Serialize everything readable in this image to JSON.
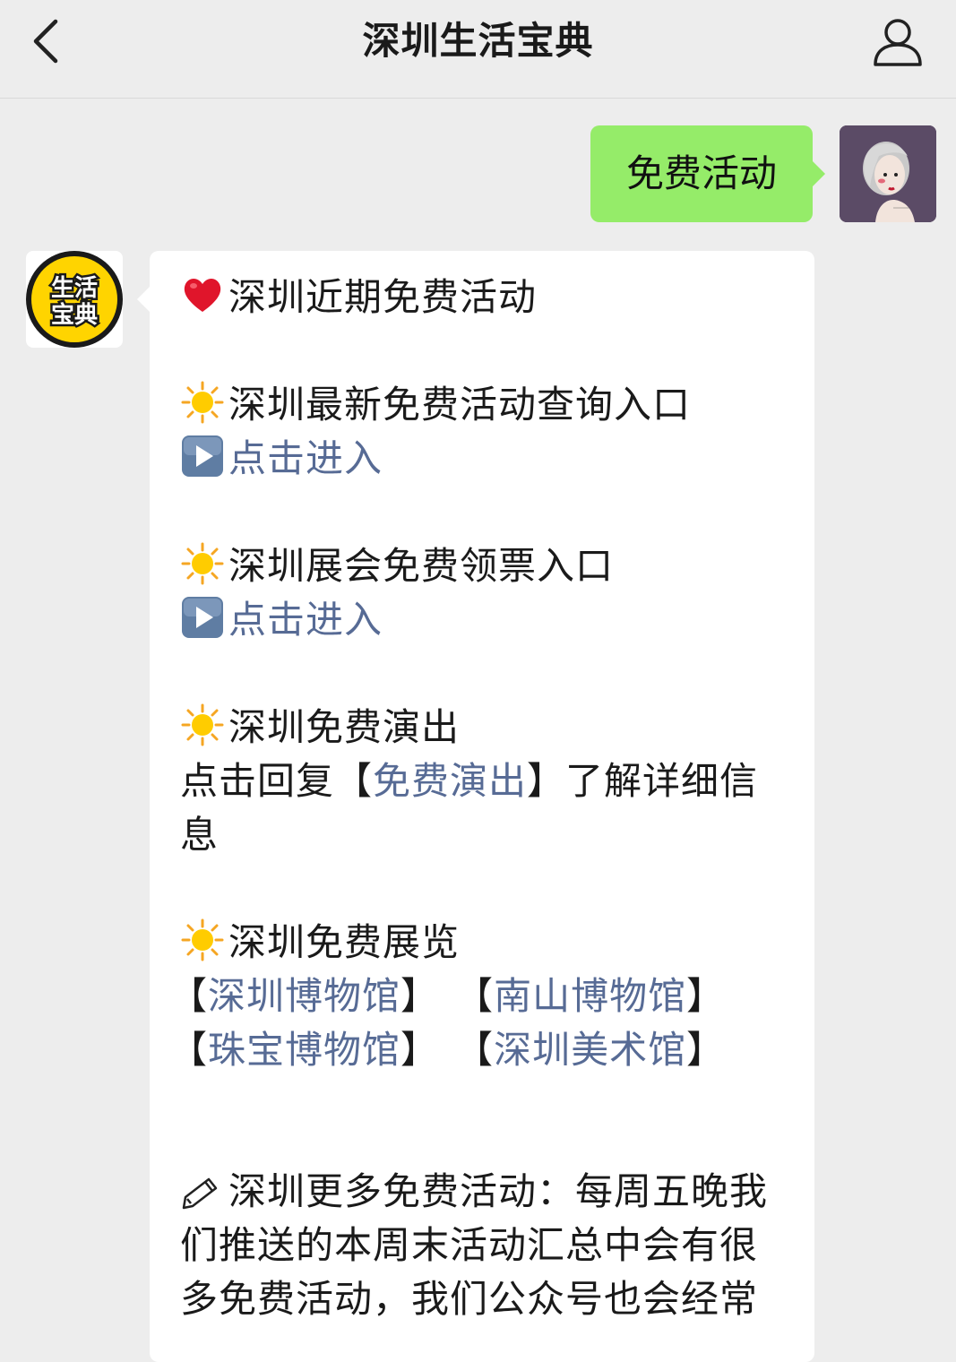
{
  "header": {
    "title": "深圳生活宝典"
  },
  "chat": {
    "user_message": "免费活动",
    "bot_avatar_text": [
      "生活",
      "宝典"
    ],
    "bot_message": {
      "heading": "深圳近期免费活动",
      "section1_title": "深圳最新免费活动查询入口",
      "section1_link": "点击进入",
      "section2_title": "深圳展会免费领票入口",
      "section2_link": "点击进入",
      "section3_title": "深圳免费演出",
      "section3_prefix": "点击回复【",
      "section3_keyword": "免费演出",
      "section3_suffix_line1": "】了解详细信",
      "section3_suffix_line2": "息",
      "section4_title": "深圳免费展览",
      "museum1": "深圳博物馆",
      "museum2": "南山博物馆",
      "museum3": "珠宝博物馆",
      "museum4": "深圳美术馆",
      "bracket_open": "【",
      "bracket_close": "】",
      "footer_line1": "深圳更多免费活动：每周五晚我",
      "footer_line2": "们推送的本周末活动汇总中会有很",
      "footer_line3": "多免费活动，我们公众号也会经常"
    }
  },
  "icons": {
    "back": "chevron-left-icon",
    "profile": "person-icon",
    "heart": "heart-emoji",
    "sun": "sun-emoji",
    "play": "play-button-emoji",
    "pencil": "pencil-emoji"
  },
  "colors": {
    "background": "#ededed",
    "user_bubble": "#95ec69",
    "bot_bubble": "#ffffff",
    "link": "#576b95",
    "badge_yellow": "#ffd400"
  }
}
